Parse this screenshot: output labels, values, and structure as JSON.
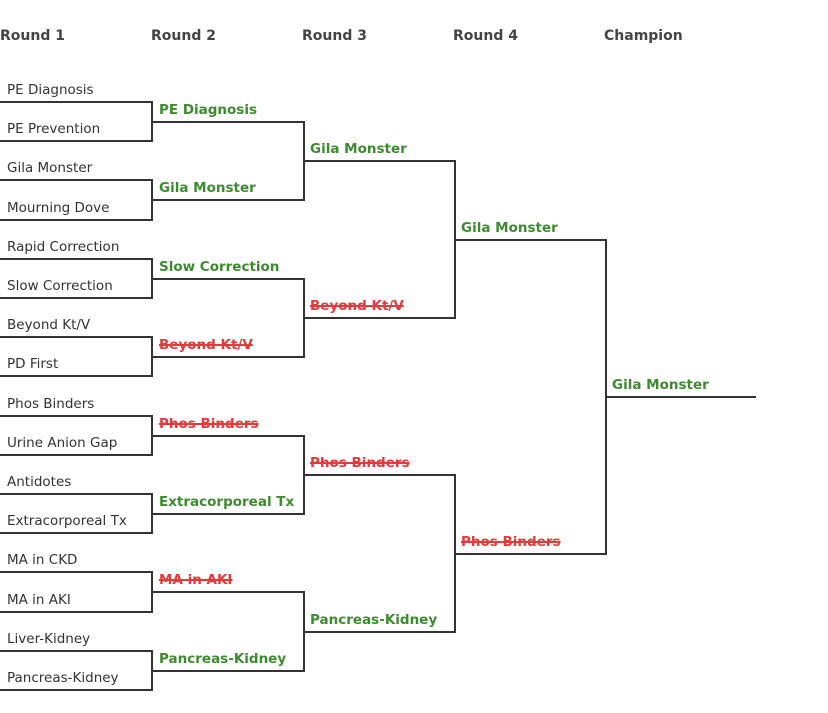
{
  "headers": [
    "Round 1",
    "Round 2",
    "Round 3",
    "Round 4",
    "Champion"
  ],
  "rounds": [
    {
      "name": "Round 1",
      "entries": [
        {
          "label": "PE Diagnosis",
          "status": "neutral"
        },
        {
          "label": "PE Prevention",
          "status": "neutral"
        },
        {
          "label": "Gila Monster",
          "status": "neutral"
        },
        {
          "label": "Mourning Dove",
          "status": "neutral"
        },
        {
          "label": "Rapid Correction",
          "status": "neutral"
        },
        {
          "label": "Slow Correction",
          "status": "neutral"
        },
        {
          "label": "Beyond Kt/V",
          "status": "neutral"
        },
        {
          "label": "PD First",
          "status": "neutral"
        },
        {
          "label": "Phos Binders",
          "status": "neutral"
        },
        {
          "label": "Urine Anion Gap",
          "status": "neutral"
        },
        {
          "label": "Antidotes",
          "status": "neutral"
        },
        {
          "label": "Extracorporeal Tx",
          "status": "neutral"
        },
        {
          "label": "MA in CKD",
          "status": "neutral"
        },
        {
          "label": "MA in AKI",
          "status": "neutral"
        },
        {
          "label": "Liver-Kidney",
          "status": "neutral"
        },
        {
          "label": "Pancreas-Kidney",
          "status": "neutral"
        }
      ]
    },
    {
      "name": "Round 2",
      "entries": [
        {
          "label": "PE Diagnosis",
          "status": "correct"
        },
        {
          "label": "Gila Monster",
          "status": "correct"
        },
        {
          "label": "Slow Correction",
          "status": "correct"
        },
        {
          "label": "Beyond Kt/V",
          "status": "incorrect"
        },
        {
          "label": "Phos Binders",
          "status": "incorrect"
        },
        {
          "label": "Extracorporeal Tx",
          "status": "correct"
        },
        {
          "label": "MA in AKI",
          "status": "incorrect"
        },
        {
          "label": "Pancreas-Kidney",
          "status": "correct"
        }
      ]
    },
    {
      "name": "Round 3",
      "entries": [
        {
          "label": "Gila Monster",
          "status": "correct"
        },
        {
          "label": "Beyond Kt/V",
          "status": "incorrect"
        },
        {
          "label": "Phos Binders",
          "status": "incorrect"
        },
        {
          "label": "Pancreas-Kidney",
          "status": "correct"
        }
      ]
    },
    {
      "name": "Round 4",
      "entries": [
        {
          "label": "Gila Monster",
          "status": "correct"
        },
        {
          "label": "Phos Binders",
          "status": "incorrect"
        }
      ]
    },
    {
      "name": "Champion",
      "entries": [
        {
          "label": "Gila Monster",
          "status": "correct"
        }
      ]
    }
  ],
  "colors": {
    "correct": "#3d8b2f",
    "incorrect": "#e23b3b",
    "neutral": "#333333",
    "line": "#333333",
    "header": "#444444"
  }
}
